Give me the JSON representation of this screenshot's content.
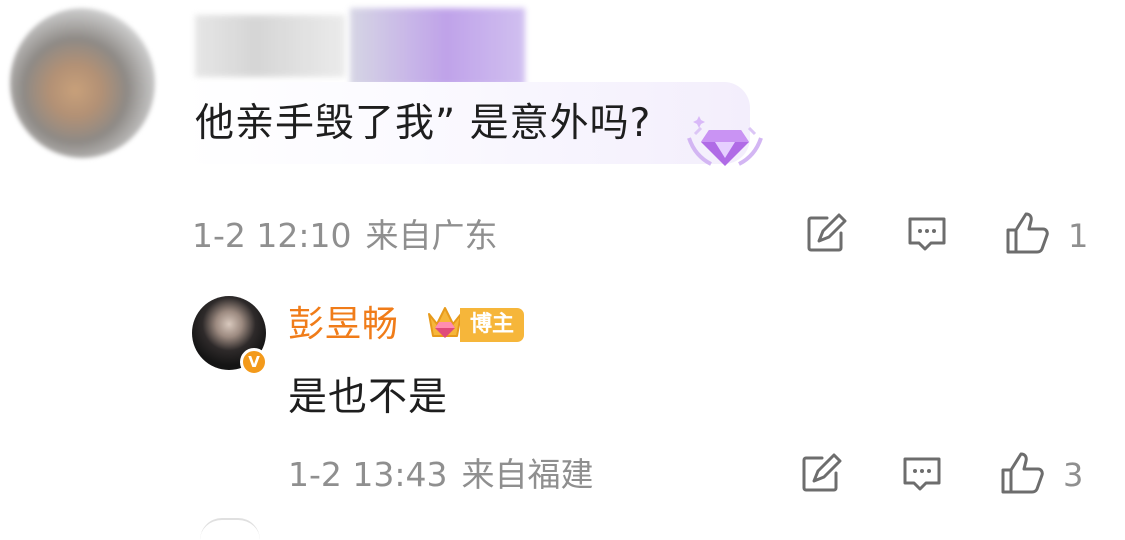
{
  "comment": {
    "text": "他亲手毁了我” 是意外吗?",
    "time": "1-2 12:10",
    "location": "来自广东",
    "like_count": "1"
  },
  "reply": {
    "author": "彭昱畅",
    "badge_label": "博主",
    "verified_mark": "V",
    "text": "是也不是",
    "time": "1-2 13:43",
    "location": "来自福建",
    "like_count": "3"
  },
  "colors": {
    "author_name": "#f07c19",
    "meta": "#8f8f8f",
    "badge_gold": "#f6b63a",
    "gem_purple": "#b06be6"
  },
  "icons": {
    "share": "share-edit-icon",
    "comment": "comment-icon",
    "like": "thumbs-up-icon",
    "gem": "gem-badge-icon",
    "crown": "crown-icon"
  }
}
